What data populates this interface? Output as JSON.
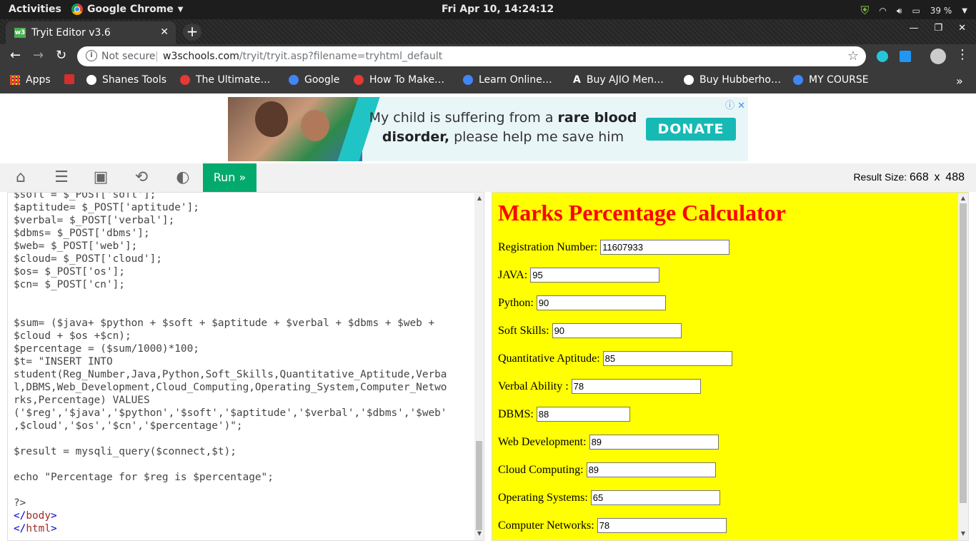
{
  "system_bar": {
    "activities": "Activities",
    "app_name": "Google Chrome",
    "clock": "Fri Apr 10, 14:24:12",
    "battery": "39 %"
  },
  "browser": {
    "tab_title": "Tryit Editor v3.6",
    "favicon_text": "w3",
    "security_label": "Not secure",
    "url_host": "w3schools.com",
    "url_path": "/tryit/tryit.asp?filename=tryhtml_default",
    "bookmarks": [
      {
        "label": "Apps",
        "color": "#e53935"
      },
      {
        "label": "",
        "color": "#d32f2f"
      },
      {
        "label": "Shanes Tools",
        "color": "#ffffff"
      },
      {
        "label": "The Ultimate…",
        "color": "#e53935"
      },
      {
        "label": "Google",
        "color": "#4285f4"
      },
      {
        "label": "How To Make…",
        "color": "#e53935"
      },
      {
        "label": "Learn Online…",
        "color": "#4285f4"
      },
      {
        "label": "Buy AJIO Men…",
        "color": "#ffffff"
      },
      {
        "label": "Buy Hubberho…",
        "color": "#ffffff"
      },
      {
        "label": "MY COURSE",
        "color": "#4285f4"
      }
    ]
  },
  "ad": {
    "text_plain_1": "My child is suffering from a ",
    "text_bold_1": "rare blood disorder,",
    "text_plain_2": " please help me save him",
    "button": "DONATE"
  },
  "editor": {
    "run_label": "Run »",
    "result_size_label": "Result Size:",
    "result_width": "668",
    "result_x": "x",
    "result_height": "488",
    "code_lines": [
      "$soft = $_POST['soft'];",
      "$aptitude= $_POST['aptitude'];",
      "$verbal= $_POST['verbal'];",
      "$dbms= $_POST['dbms'];",
      "$web= $_POST['web'];",
      "$cloud= $_POST['cloud'];",
      "$os= $_POST['os'];",
      "$cn= $_POST['cn'];",
      "",
      "",
      "$sum= ($java+ $python + $soft + $aptitude + $verbal + $dbms + $web +",
      "$cloud + $os +$cn);",
      "$percentage = ($sum/1000)*100;",
      "$t= \"INSERT INTO",
      "student(Reg_Number,Java,Python,Soft_Skills,Quantitative_Aptitude,Verba",
      "l,DBMS,Web_Development,Cloud_Computing,Operating_System,Computer_Netwo",
      "rks,Percentage) VALUES",
      "('$reg','$java','$python','$soft','$aptitude','$verbal','$dbms','$web'",
      ",$cloud','$os','$cn','$percentage')\";",
      "",
      "$result = mysqli_query($connect,$t);",
      "",
      "echo \"Percentage for $reg is $percentage\";",
      "",
      "?>"
    ],
    "closing_tags": [
      "body",
      "html"
    ]
  },
  "result": {
    "heading": "Marks Percentage Calculator",
    "fields": [
      {
        "label": "Registration Number:",
        "value": "11607933"
      },
      {
        "label": "JAVA:",
        "value": "95"
      },
      {
        "label": "Python:",
        "value": "90"
      },
      {
        "label": "Soft Skills:",
        "value": "90"
      },
      {
        "label": "Quantitative Aptitude:",
        "value": "85"
      },
      {
        "label": "Verbal Ability :",
        "value": "78"
      },
      {
        "label": "DBMS:",
        "value": "88"
      },
      {
        "label": "Web Development:",
        "value": "89"
      },
      {
        "label": "Cloud Computing:",
        "value": "89"
      },
      {
        "label": "Operating Systems:",
        "value": "65"
      },
      {
        "label": "Computer Networks:",
        "value": "78"
      }
    ]
  }
}
